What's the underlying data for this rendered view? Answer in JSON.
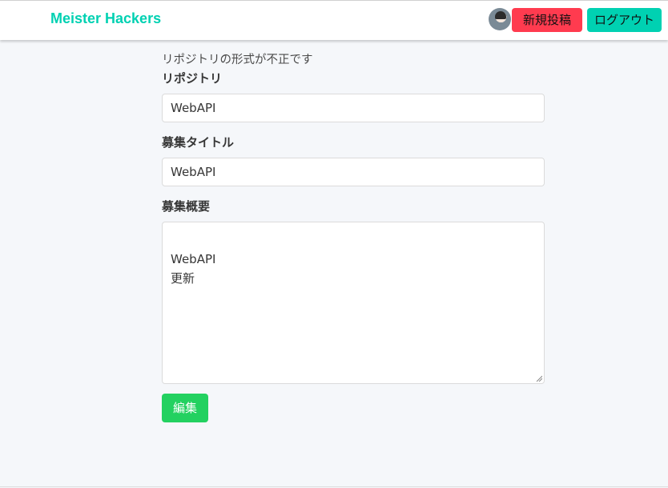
{
  "header": {
    "brand": "Meister Hackers",
    "new_post_label": "新規投稿",
    "logout_label": "ログアウト",
    "brand_color": "#00d1b2",
    "new_post_color": "#ff3b4f",
    "logout_color": "#00d1b2"
  },
  "form": {
    "error_message": "リポジトリの形式が不正です",
    "repository_label": "リポジトリ",
    "repository_value": "WebAPI",
    "title_label": "募集タイトル",
    "title_value": "WebAPI",
    "summary_label": "募集概要",
    "summary_value": "WebAPI\n更新",
    "submit_label": "編集",
    "submit_color": "#23d160"
  }
}
